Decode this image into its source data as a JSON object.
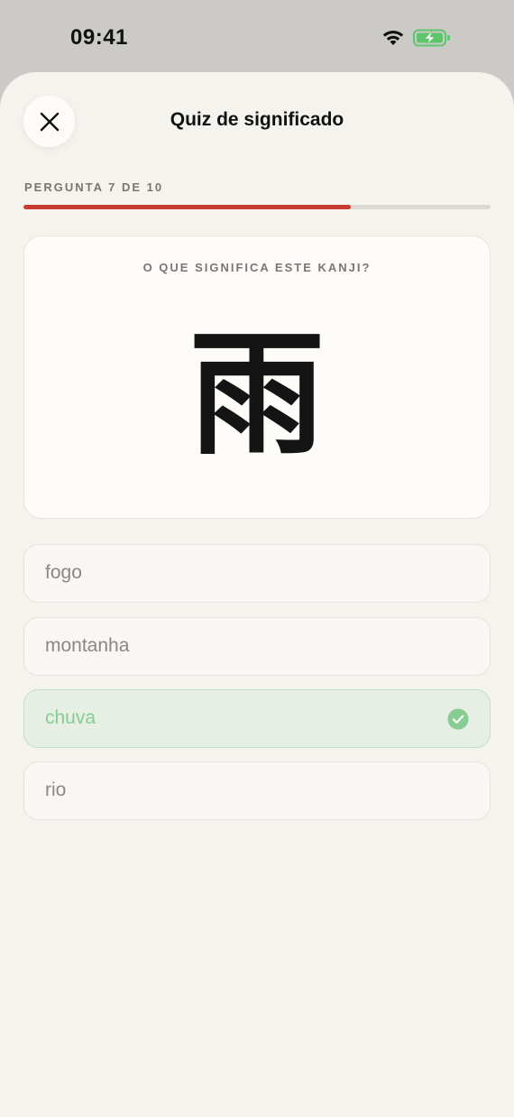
{
  "status_bar": {
    "time": "09:41"
  },
  "header": {
    "title": "Quiz de significado",
    "close_icon": "close-icon"
  },
  "progress": {
    "label": "PERGUNTA 7 DE 10",
    "fraction": 0.7,
    "fill_color": "#c93a33"
  },
  "question": {
    "prompt": "O QUE SIGNIFICA ESTE KANJI?",
    "kanji": "雨"
  },
  "options": [
    {
      "label": "fogo",
      "state": "default"
    },
    {
      "label": "montanha",
      "state": "default"
    },
    {
      "label": "chuva",
      "state": "correct",
      "icon": "check-circle-icon"
    },
    {
      "label": "rio",
      "state": "default"
    }
  ],
  "colors": {
    "correct_bg": "#e7efe4",
    "correct_text": "#86cc93",
    "sheet_bg": "#f5f3ee"
  }
}
